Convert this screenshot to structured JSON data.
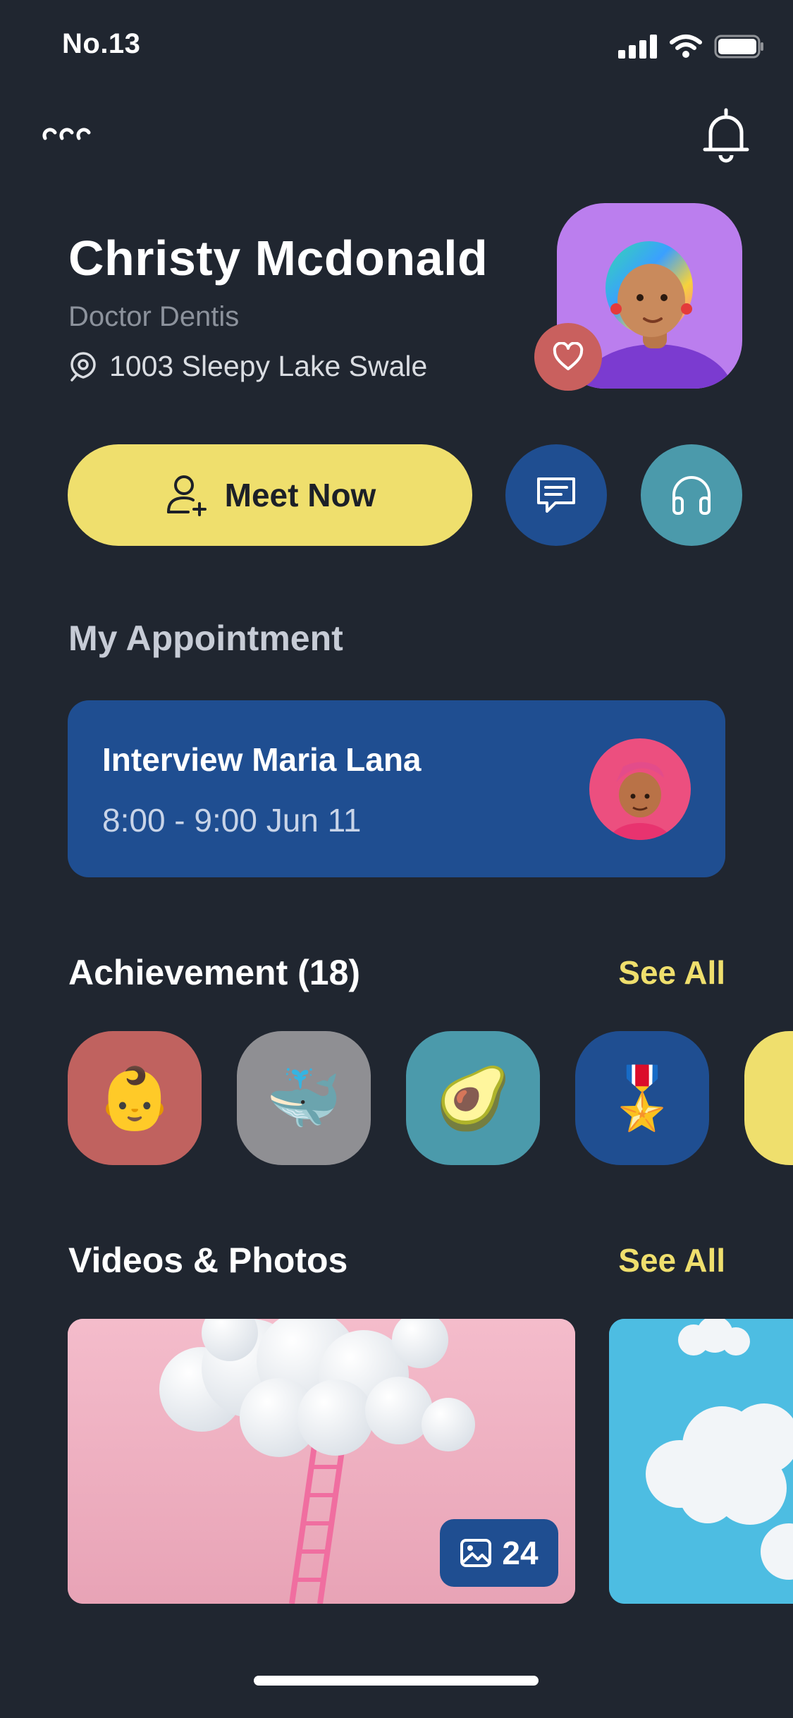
{
  "status_bar": {
    "time": "No.13"
  },
  "profile": {
    "name": "Christy Mcdonald",
    "role": "Doctor Dentis",
    "address": "1003 Sleepy Lake Swale"
  },
  "actions": {
    "meet_label": "Meet Now",
    "chat_icon": "chat-bubble-icon",
    "support_icon": "headphones-icon"
  },
  "appointments": {
    "title": "My Appointment",
    "card": {
      "title": "Interview Maria Lana",
      "time": "8:00 - 9:00 Jun 11"
    }
  },
  "achievements": {
    "title": "Achievement (18)",
    "see_all": "See All",
    "items": [
      {
        "emoji": "👶",
        "color": "#c0625f"
      },
      {
        "emoji": "🐳",
        "color": "#8f8f93"
      },
      {
        "emoji": "🥑",
        "color": "#4b9aab"
      },
      {
        "emoji": "🎖️",
        "color": "#1f4e91"
      },
      {
        "emoji": "",
        "color": "#efdf6d"
      }
    ]
  },
  "media": {
    "title": "Videos & Photos",
    "see_all": "See All",
    "photo_count": "24"
  },
  "colors": {
    "background": "#202630",
    "accent_yellow": "#efdf6d",
    "primary_blue": "#1f4e91",
    "teal": "#4b9aab"
  }
}
